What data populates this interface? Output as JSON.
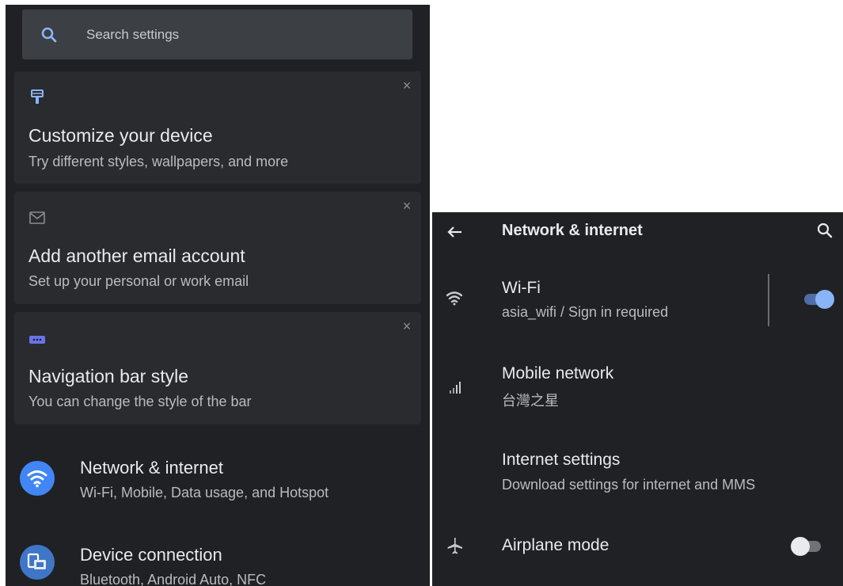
{
  "left_panel": {
    "search": {
      "placeholder": "Search settings",
      "icon": "search-icon"
    },
    "cards": [
      {
        "icon": "brush-icon",
        "title": "Customize your device",
        "subtitle": "Try different styles, wallpapers, and more",
        "close": "×"
      },
      {
        "icon": "gmail-icon",
        "title": "Add another email account",
        "subtitle": "Set up your personal or work email",
        "close": "×"
      },
      {
        "icon": "navigation-bar-icon",
        "title": "Navigation bar style",
        "subtitle": "You can change the style of the bar",
        "close": "×"
      }
    ],
    "items": [
      {
        "icon": "wifi-icon",
        "title": "Network & internet",
        "subtitle": "Wi-Fi, Mobile, Data usage, and Hotspot",
        "color": "#4285f4"
      },
      {
        "icon": "device-connection-icon",
        "title": "Device connection",
        "subtitle": "Bluetooth, Android Auto, NFC",
        "color": "#3f76c7"
      }
    ]
  },
  "right_panel": {
    "title": "Network & internet",
    "rows": [
      {
        "icon": "wifi-icon",
        "title": "Wi-Fi",
        "subtitle": "asia_wifi / Sign in required",
        "toggle": true
      },
      {
        "icon": "signal-icon",
        "title": "Mobile network",
        "subtitle": "台灣之星"
      },
      {
        "icon": "",
        "title": "Internet settings",
        "subtitle": "Download settings for internet and MMS"
      },
      {
        "icon": "airplane-icon",
        "title": "Airplane mode",
        "subtitle": "",
        "toggle": false
      }
    ]
  },
  "colors": {
    "accent": "#8ab4f8",
    "toggle_on_track": "#4f6ea8",
    "bg": "#202124",
    "card": "#2a2b2e"
  }
}
